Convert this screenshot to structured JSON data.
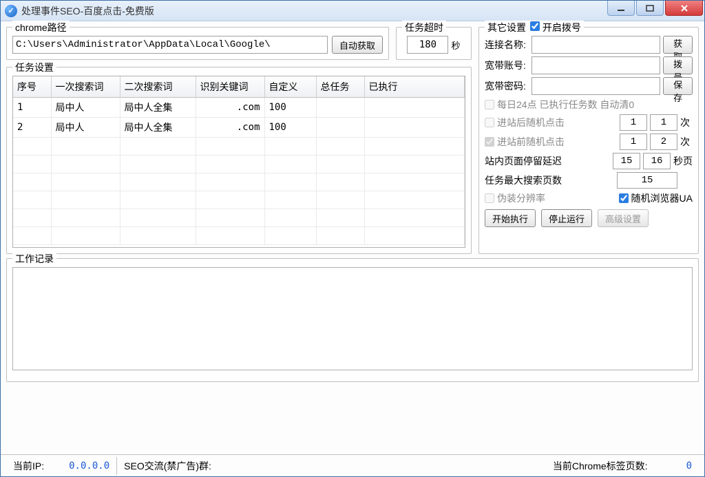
{
  "title": "处理事件SEO-百度点击-免费版",
  "chrome_group": {
    "legend": "chrome路径",
    "path": "C:\\Users\\Administrator\\AppData\\Local\\Google\\",
    "auto_btn": "自动获取"
  },
  "timeout_group": {
    "legend": "任务超时",
    "value": "180",
    "unit": "秒"
  },
  "settings_group": {
    "legend": "其它设置",
    "enable_dial": "开启拨号",
    "rows": {
      "conn_name_label": "连接名称:",
      "get_btn": "获取",
      "bb_account_label": "宽带账号:",
      "dial_btn": "拨号",
      "bb_password_label": "宽带密码:",
      "save_btn": "保存",
      "daily_24_label": "每日24点 已执行任务数 自动清0",
      "after_enter_label": "进站后随机点击",
      "after_enter_min": "1",
      "after_enter_max": "1",
      "times": "次",
      "before_enter_label": "进站前随机点击",
      "before_enter_min": "1",
      "before_enter_max": "2",
      "stay_delay_label": "站内页面停留延迟",
      "stay_min": "15",
      "stay_max": "16",
      "seconds_page": "秒页",
      "max_search_pages_label": "任务最大搜索页数",
      "max_search_pages": "15",
      "fake_res_label": "伪装分辨率",
      "random_ua_label": "随机浏览器UA"
    },
    "actions": {
      "start": "开始执行",
      "stop": "停止运行",
      "advanced": "高级设置"
    }
  },
  "task_group": {
    "legend": "任务设置",
    "columns": [
      "序号",
      "一次搜索词",
      "二次搜索词",
      "识别关键词",
      "自定义",
      "总任务",
      "已执行"
    ],
    "rows": [
      {
        "c0": "1",
        "c1": "局中人",
        "c2": "局中人全集",
        "c3": ".com",
        "c4": "100",
        "c5": "",
        "c6": ""
      },
      {
        "c0": "2",
        "c1": "局中人",
        "c2": "局中人全集",
        "c3": ".com",
        "c4": "100",
        "c5": "",
        "c6": ""
      }
    ]
  },
  "log_group": {
    "legend": "工作记录"
  },
  "status": {
    "ip_label": "当前IP:",
    "ip_value": "0.0.0.0",
    "group_label": "SEO交流(禁广告)群:",
    "tabs_label": "当前Chrome标签页数:",
    "tabs_value": "0"
  }
}
